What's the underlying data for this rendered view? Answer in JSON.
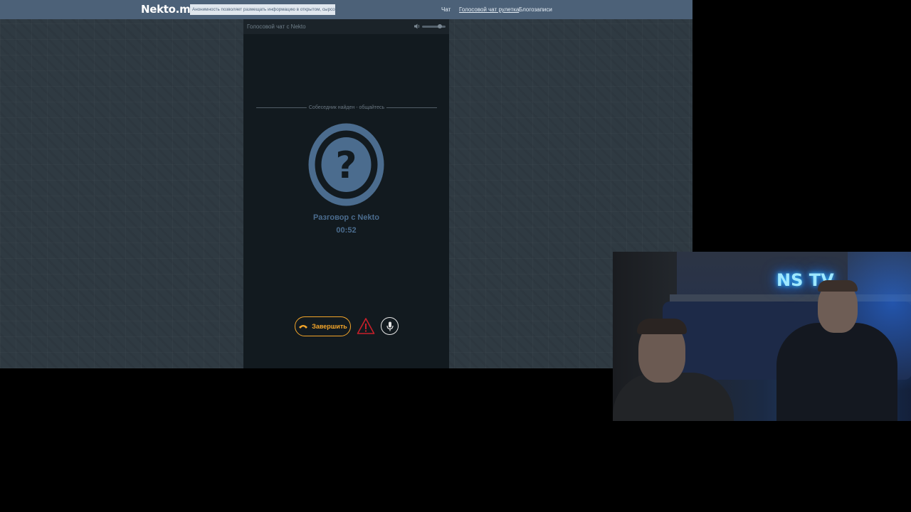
{
  "site": {
    "logo": "Nekto.me",
    "notice": "Анонимность позволяет размещать информацию в открытом, сырсом виде!",
    "nav": [
      {
        "label": "Чат",
        "active": false
      },
      {
        "label": "Голосовой чат рулетка",
        "active": true
      },
      {
        "label": "Блогозаписи",
        "active": false
      }
    ],
    "colors": {
      "topbar": "#4c6178",
      "panel": "#121a1f",
      "accent_orange": "#f4a62a",
      "avatar_blue": "#4b6c8e",
      "report_red": "#c8202a"
    }
  },
  "panel": {
    "title": "Голосовой чат с Nekto",
    "volume_icon": "speaker-icon",
    "volume_level": 0.8,
    "status": "Собеседник найден - общайтесь",
    "avatar_icon": "question-mark-icon",
    "call_title": "Разговор с Nekto",
    "timer": "00:52"
  },
  "controls": {
    "end_label": "Завершить",
    "end_icon": "hang-up-phone-icon",
    "report_icon": "warning-triangle-icon",
    "mic_icon": "microphone-icon"
  },
  "webcam": {
    "neon_sign": "NS TV"
  }
}
